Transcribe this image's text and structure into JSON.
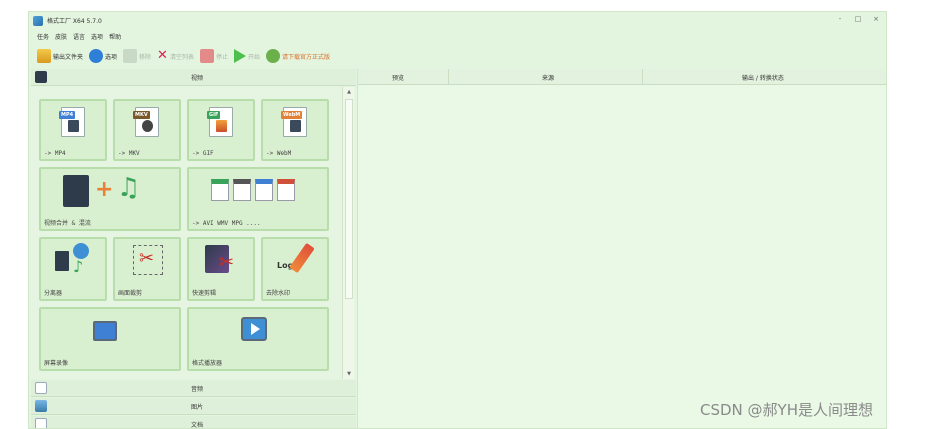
{
  "window": {
    "title": "格式工厂 X64 5.7.0",
    "controls": [
      "-",
      "□",
      "×"
    ]
  },
  "menu": [
    "任务",
    "皮肤",
    "语言",
    "选项",
    "帮助"
  ],
  "toolbar": {
    "output_folder": "输出文件夹",
    "options": "选项",
    "remove": "移除",
    "clear_list": "清空列表",
    "stop": "停止",
    "start": "开始",
    "download_official": "请下载官方正式版"
  },
  "sidebar": {
    "video_header": "视频",
    "tiles": [
      {
        "label": "-> MP4",
        "badge": "MP4",
        "badge_color": "#3f7fd4"
      },
      {
        "label": "-> MKV",
        "badge": "MKV",
        "badge_color": "#7a5a2a"
      },
      {
        "label": "-> GIF",
        "badge": "GIF",
        "badge_color": "#3aa35a"
      },
      {
        "label": "-> WebM",
        "badge": "WebM",
        "badge_color": "#e0813a"
      },
      {
        "label": "视频合并 & 混流"
      },
      {
        "label": "-> AVI WMV MPG ...."
      },
      {
        "label": "分离器"
      },
      {
        "label": "画面裁剪"
      },
      {
        "label": "快速剪辑"
      },
      {
        "label": "去除水印",
        "logo_text": "Logo"
      },
      {
        "label": "屏幕录像"
      },
      {
        "label": "格式播放器"
      }
    ],
    "audio_header": "音频",
    "image_header": "图片",
    "document_header": "文档"
  },
  "columns": {
    "preview": "预览",
    "source": "来源",
    "output_status": "输出 / 转换状态"
  },
  "watermark": "CSDN @郝YH是人间理想"
}
